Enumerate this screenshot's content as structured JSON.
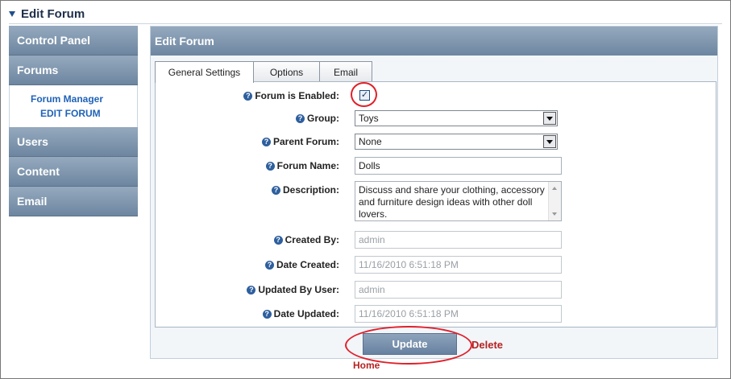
{
  "page": {
    "title": "Edit Forum"
  },
  "sidebar": {
    "items": [
      {
        "label": "Control Panel"
      },
      {
        "label": "Forums"
      },
      {
        "label": "Users"
      },
      {
        "label": "Content"
      },
      {
        "label": "Email"
      }
    ],
    "sub": {
      "forum_manager": "Forum Manager",
      "edit_forum": "EDIT FORUM"
    }
  },
  "panel": {
    "title": "Edit Forum",
    "tabs": [
      {
        "label": "General Settings"
      },
      {
        "label": "Options"
      },
      {
        "label": "Email"
      }
    ]
  },
  "form": {
    "enabled": {
      "label": "Forum is Enabled:",
      "checked": true,
      "mark": "✓"
    },
    "group": {
      "label": "Group:",
      "value": "Toys"
    },
    "parent": {
      "label": "Parent Forum:",
      "value": "None"
    },
    "name": {
      "label": "Forum Name:",
      "value": "Dolls"
    },
    "description": {
      "label": "Description:",
      "value": "Discuss and share your clothing, accessory and furniture design ideas with other doll lovers."
    },
    "created_by": {
      "label": "Created By:",
      "value": "admin"
    },
    "date_created": {
      "label": "Date Created:",
      "value": "11/16/2010 6:51:18 PM"
    },
    "updated_by": {
      "label": "Updated By User:",
      "value": "admin"
    },
    "date_updated": {
      "label": "Date Updated:",
      "value": "11/16/2010 6:51:18 PM"
    },
    "help_glyph": "?"
  },
  "actions": {
    "update": "Update",
    "delete": "Delete",
    "home": "Home"
  },
  "colors": {
    "accent": "#1f62b8",
    "header": "#7f97b0",
    "highlight": "#e0202a",
    "link_red": "#b52222"
  }
}
